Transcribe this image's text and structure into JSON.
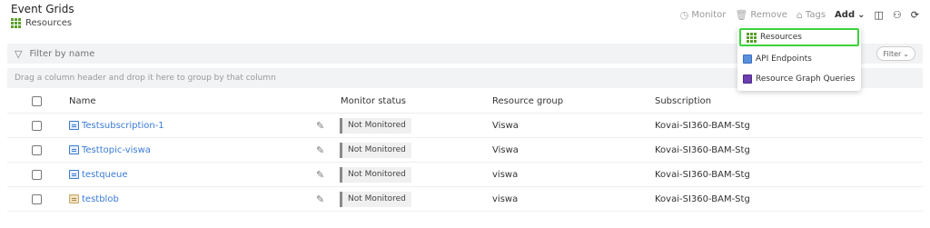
{
  "header": {
    "title": "Event Grids",
    "breadcrumb": "Resources"
  },
  "toolbar": {
    "monitor": "Monitor",
    "remove": "Remove",
    "tags": "Tags",
    "add": "Add"
  },
  "filter": {
    "placeholder": "Filter by name",
    "button": "Filter"
  },
  "group_hint": "Drag a column header and drop it here to group by that column",
  "table": {
    "columns": [
      "Name",
      "Monitor status",
      "Resource group",
      "Subscription"
    ],
    "rows": [
      {
        "name": "Testsubscription-1",
        "status": "Not Monitored",
        "group": "Viswa",
        "subscription": "Kovai-SI360-BAM-Stg"
      },
      {
        "name": "Testtopic-viswa",
        "status": "Not Monitored",
        "group": "Viswa",
        "subscription": "Kovai-SI360-BAM-Stg"
      },
      {
        "name": "testqueue",
        "status": "Not Monitored",
        "group": "viswa",
        "subscription": "Kovai-SI360-BAM-Stg"
      },
      {
        "name": "testblob",
        "status": "Not Monitored",
        "group": "viswa",
        "subscription": "Kovai-SI360-BAM-Stg"
      }
    ]
  },
  "dropdown": {
    "items": [
      "Resources",
      "API Endpoints",
      "Resource Graph Queries"
    ],
    "selected": "Resources"
  },
  "colors": {
    "link": "#3a7bd5",
    "highlight": "#3cd33c",
    "resource_grid": "#5a9e2b"
  }
}
